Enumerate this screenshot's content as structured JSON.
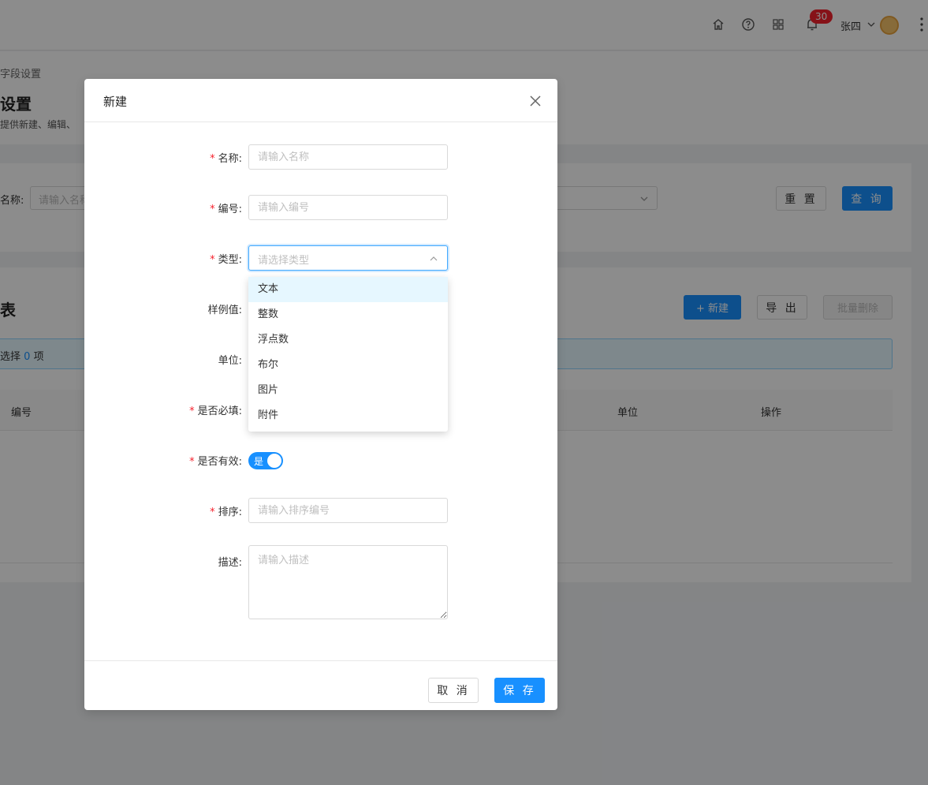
{
  "header": {
    "icons": [
      "home-icon",
      "help-icon",
      "apps-icon",
      "bell-icon"
    ],
    "notification_count": "30",
    "user_name": "张四"
  },
  "page": {
    "breadcrumb": "字段设置",
    "title": "设置",
    "description": "提供新建、编辑、"
  },
  "search": {
    "name_label": "名称:",
    "name_placeholder": "请输入名称",
    "reset_label": "重 置",
    "query_label": "查 询"
  },
  "list": {
    "title": "表",
    "new_label": "+ 新建",
    "export_label": "导 出",
    "batch_delete_label": "批量删除",
    "selected_prefix": "选择",
    "selected_count": "0",
    "selected_suffix": "项",
    "columns": [
      "编号",
      "单位",
      "操作"
    ]
  },
  "modal": {
    "title": "新建",
    "fields": {
      "name_label": "名称:",
      "name_placeholder": "请输入名称",
      "code_label": "编号:",
      "code_placeholder": "请输入编号",
      "type_label": "类型:",
      "type_placeholder": "请选择类型",
      "sample_label": "样例值:",
      "unit_label": "单位:",
      "required_label": "是否必填:",
      "valid_label": "是否有效:",
      "valid_value": "是",
      "sort_label": "排序:",
      "sort_placeholder": "请输入排序编号",
      "desc_label": "描述:",
      "desc_placeholder": "请输入描述"
    },
    "type_options": [
      "文本",
      "整数",
      "浮点数",
      "布尔",
      "图片",
      "附件"
    ],
    "cancel_label": "取 消",
    "save_label": "保 存"
  },
  "colors": {
    "primary": "#1890ff",
    "required_mark": "#f5222d",
    "badge": "#f5222d"
  }
}
